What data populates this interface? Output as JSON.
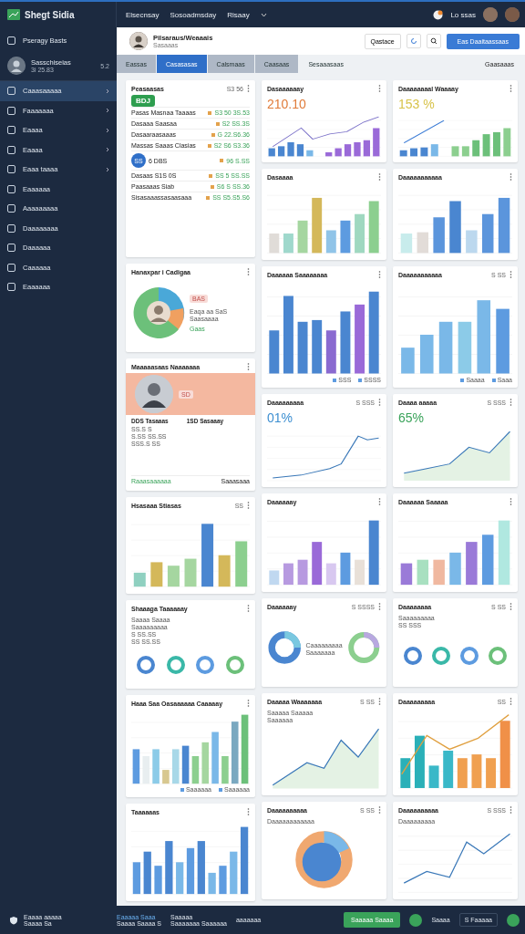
{
  "topbar": {
    "logo": "Shegt Sidia",
    "links": [
      "Elsecnsay",
      "Sosoadmsday",
      "Risaay"
    ],
    "user_label": "Lo ssas"
  },
  "sidebar": {
    "header": "Pseragy Basts",
    "user": {
      "name": "Sasschiseias",
      "sub": "3i 25.83",
      "badge": "5.2"
    },
    "items": [
      {
        "label": "Caaasaaaaa",
        "selected": true,
        "expandable": true
      },
      {
        "label": "Faaaaaaa",
        "selected": false,
        "expandable": true
      },
      {
        "label": "Eaaaa",
        "selected": false,
        "expandable": true
      },
      {
        "label": "Eaaaa",
        "selected": false,
        "expandable": true
      },
      {
        "label": "Eaaa taaaa",
        "selected": false,
        "expandable": true
      },
      {
        "label": "Eaaaaaa",
        "selected": false,
        "expandable": false
      },
      {
        "label": "Aaaaaaaaa",
        "selected": false,
        "expandable": false
      },
      {
        "label": "Daaaaaaaa",
        "selected": false,
        "expandable": false
      },
      {
        "label": "Daaaaaa",
        "selected": false,
        "expandable": false
      },
      {
        "label": "Caaaaaa",
        "selected": false,
        "expandable": false
      },
      {
        "label": "Eaaaaaa",
        "selected": false,
        "expandable": false
      }
    ]
  },
  "header": {
    "name": "Pilsaraus/Weaaais",
    "sub": "Sasaaas",
    "button": "Qastace",
    "primary": "Eas Daaitaassaas"
  },
  "tabs": [
    {
      "label": "Eassas",
      "selected": false
    },
    {
      "label": "Casasasas",
      "selected": true
    },
    {
      "label": "Calsmaas",
      "selected": false
    },
    {
      "label": "Caasaas",
      "selected": false
    },
    {
      "label": "Sesaaasaas",
      "selected": false
    }
  ],
  "tabs_right": "Gaasaaas",
  "columns": [
    [
      {
        "kind": "list",
        "title": "Peasaasas",
        "meta": "S3 56",
        "value": "BDJ",
        "rows": [
          {
            "label": "Pasas Masnaa Taaaas",
            "value": "S3 50 3S.53"
          },
          {
            "label": "Dasaaa Saasaa",
            "value": "S2 SS.3S"
          },
          {
            "label": "Dasaaraasaaas",
            "value": "G 22.S6.36"
          },
          {
            "label": "Massas Saaas Clasias",
            "value": "S2 S6 S3.36"
          },
          {
            "label": "6 DBS",
            "value": "96 S.SS",
            "badge": "SS"
          },
          {
            "label": "Dasaas S1S 0S",
            "value": "SS 5 SS.SS"
          },
          {
            "label": "Paasaaas Siab",
            "value": "S6 S SS.36"
          },
          {
            "label": "Sisasaaassasaasaaa",
            "value": "SS S5.S5.S6"
          }
        ]
      },
      {
        "kind": "pie_avatar",
        "title": "Hanaxpar i Cadigaa",
        "tag": "BAS",
        "lines": [
          "Eaqa aa SaS",
          "Saasaaaa"
        ],
        "link": "Gaas"
      },
      {
        "kind": "profile",
        "title": "Maaaaasaas Naaaaaaa",
        "tag": "SD",
        "stats": [
          "DDS Tasaaas",
          "1SD Sasaaay"
        ],
        "rows": [
          "SS.S S",
          "S.SS SS.SS",
          "SSS.S SS"
        ],
        "footer": [
          "Raaasaaaaaa",
          "Saaasaaa"
        ]
      },
      {
        "kind": "bar",
        "title": "Hsasaaa Stiasas",
        "meta": "SS"
      },
      {
        "kind": "rings",
        "title": "Shaaaga Taaaaaay",
        "lines": [
          "Saaaa Saaaa",
          "Saaaaaaaaa",
          "S SS.SS",
          "SS SS.SS"
        ]
      },
      {
        "kind": "bar",
        "title": "Haaa Saa Oasaaaaaa Caaaaay",
        "legend": [
          "Saaaaaa",
          "Saaaaaa"
        ]
      },
      {
        "kind": "bar",
        "title": "Taaaaaas"
      }
    ],
    [
      {
        "kind": "bar_line",
        "title": "Dasaaaaaay",
        "value": "210.10",
        "color": "#e07b39"
      },
      {
        "kind": "bar",
        "title": "Dasaaaa"
      },
      {
        "kind": "bar",
        "title": "Daaaaaa Saaaaaaaa",
        "legend": [
          "SSS",
          "SSSS"
        ]
      },
      {
        "kind": "line",
        "title": "Daaaaaaaaa",
        "meta": "S SSS",
        "value": "01%",
        "color": "#3d8fd1"
      },
      {
        "kind": "bar",
        "title": "Daaaaaay"
      },
      {
        "kind": "donuts",
        "title": "Daaaaaay",
        "meta": "S SSSS",
        "lines": [
          "Caaaaaaaaa",
          "Saaaaaaa"
        ]
      },
      {
        "kind": "area",
        "title": "Daaaaa Waaaaaaa",
        "meta": "S SS",
        "lines": [
          "Saaaaa Saaaaa",
          "Saaaaaa"
        ]
      },
      {
        "kind": "pie",
        "title": "Daaaaaaaaaa",
        "meta": "S SS",
        "lines": [
          "Daaaaaaaaaaaa"
        ]
      }
    ],
    [
      {
        "kind": "bar_line",
        "title": "Daaaaaaaal Waaaay",
        "value": "153 %",
        "color": "#d8c34a"
      },
      {
        "kind": "bar",
        "title": "Daaaaaaaaaaa"
      },
      {
        "kind": "bar",
        "title": "Daaaaaaaaaaa",
        "meta": "S SS",
        "legend": [
          "Saaaa",
          "Saaa"
        ]
      },
      {
        "kind": "area",
        "title": "Daaaa aaaaa",
        "meta": "S SSS",
        "value": "65%",
        "color": "#3aa35a"
      },
      {
        "kind": "bar",
        "title": "Daaaaaa Saaaaa"
      },
      {
        "kind": "rings",
        "title": "Daaaaaaaa",
        "meta": "S SS",
        "lines": [
          "Saaaaaaaaa",
          "SS SSS"
        ]
      },
      {
        "kind": "bar_line",
        "title": "Daaaaaaaaa",
        "meta": "SS"
      },
      {
        "kind": "line",
        "title": "Daaaaaaaaaa",
        "meta": "S SSS",
        "lines": [
          "Daaaaaaaaa"
        ]
      }
    ]
  ],
  "footer": {
    "left": [
      "Eaaaa aaaaa",
      "Saaaa Sa"
    ],
    "middle": [
      "Eaaaaa Saaa",
      "Saaaa Saaaa S"
    ],
    "middle2": [
      "Saaaaa",
      "Saaaaaaa Saaaaaa"
    ],
    "note": "aaaaaaa",
    "button": "Saaaaa Saaaa",
    "label": "Saaaa",
    "select": "S Faaaaa"
  }
}
